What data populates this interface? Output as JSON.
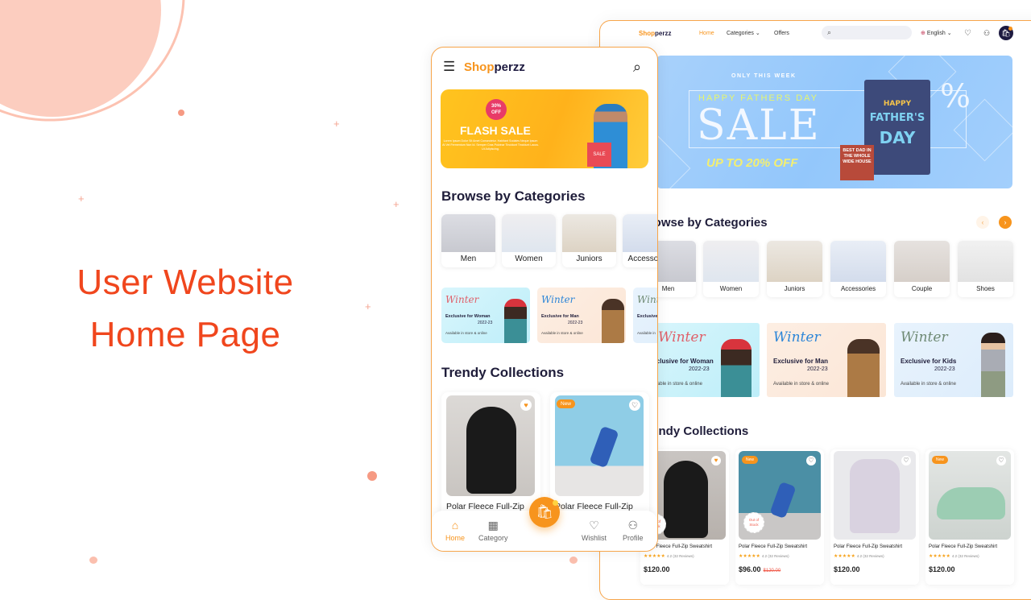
{
  "hero": {
    "title_line1": "User Website",
    "title_line2": "Home Page"
  },
  "colors": {
    "accent": "#F7941D",
    "hero_title": "#F0461D",
    "price_old": "#F05A4A"
  },
  "brand": {
    "logo_initial": "S",
    "logo_rest_accent": "hop",
    "logo_rest_dark": "perzz"
  },
  "desktop": {
    "nav": {
      "home": "Home",
      "categories": "Categories",
      "offers": "Offers",
      "language": "English",
      "search_placeholder": ""
    },
    "banner": {
      "eyebrow": "ONLY THIS WEEK",
      "headline": "HAPPY FATHERS DAY",
      "big": "SALE",
      "offer": "UP TO 20% OFF",
      "percent": "%",
      "bag_line1": "HAPPY",
      "bag_line2": "FATHER'S",
      "bag_line3": "DAY",
      "tag": "BEST DAD IN THE WHOLE WIDE HOUSE"
    },
    "categories_title": "Browse by Categories",
    "categories": [
      "Men",
      "Women",
      "Juniors",
      "Accessories",
      "Couple",
      "Shoes"
    ],
    "promos": [
      {
        "script": "Winter",
        "title": "Exclusive for Woman",
        "year": "2022-23",
        "sub": "Available in store & online"
      },
      {
        "script": "Winter",
        "title": "Exclusive for Man",
        "year": "2022-23",
        "sub": "Available in store & online"
      },
      {
        "script": "Winter",
        "title": "Exclusive for Kids",
        "year": "2022-23",
        "sub": "Available in store & online"
      }
    ],
    "collections_title": "Trendy Collections",
    "products": [
      {
        "name": "Polar Fleece Full-Zip Sweatshirt",
        "stars": "★★★★★",
        "rating": "4.2 (32 Reviews)",
        "price": "$120.00",
        "old_price": "",
        "badge": "",
        "out_of_stock": "Out of Stock"
      },
      {
        "name": "Polar Fleece Full-Zip Sweatshirt",
        "stars": "★★★★★",
        "rating": "4.2 (32 Reviews)",
        "price": "$96.00",
        "old_price": "$120.00",
        "badge": "New",
        "out_of_stock": "Out of Stock"
      },
      {
        "name": "Polar Fleece Full-Zip Sweatshirt",
        "stars": "★★★★★",
        "rating": "4.2 (32 Reviews)",
        "price": "$120.00",
        "old_price": "",
        "badge": "",
        "out_of_stock": ""
      },
      {
        "name": "Polar Fleece Full-Zip Sweatshirt",
        "stars": "★★★★★",
        "rating": "4.2 (32 Reviews)",
        "price": "$120.00",
        "old_price": "",
        "badge": "New",
        "out_of_stock": ""
      }
    ]
  },
  "mobile": {
    "banner": {
      "discount_line1": "30%",
      "discount_line2": "OFF",
      "title": "FLASH SALE",
      "body": "Lorem Ipsum Dolor Sit Amet Consectetur. Habitant Sodales Neque Ipsum At Vel Fermentum Non Id. Semper Cras Pulvinar Tincidunt Tincidunt Lacus. Ut Adipiscing.",
      "bag": "SALE"
    },
    "categories_title": "Browse by Categories",
    "categories": [
      "Men",
      "Women",
      "Juniors",
      "Accessories"
    ],
    "promos": [
      {
        "script": "Winter",
        "title": "Exclusive for Woman",
        "year": "2022-23",
        "sub": "Available in store & online"
      },
      {
        "script": "Winter",
        "title": "Exclusive for Man",
        "year": "2022-23",
        "sub": "Available in store & online"
      },
      {
        "script": "Winter",
        "title": "Exclusive",
        "year": "",
        "sub": "Available in"
      }
    ],
    "collections_title": "Trendy Collections",
    "products": [
      {
        "name": "Polar Fleece Full-Zip",
        "badge": ""
      },
      {
        "name": "Polar Fleece Full-Zip",
        "badge": "New"
      }
    ],
    "tabs": {
      "home": "Home",
      "category": "Category",
      "wishlist": "Wishlist",
      "profile": "Profile"
    }
  }
}
